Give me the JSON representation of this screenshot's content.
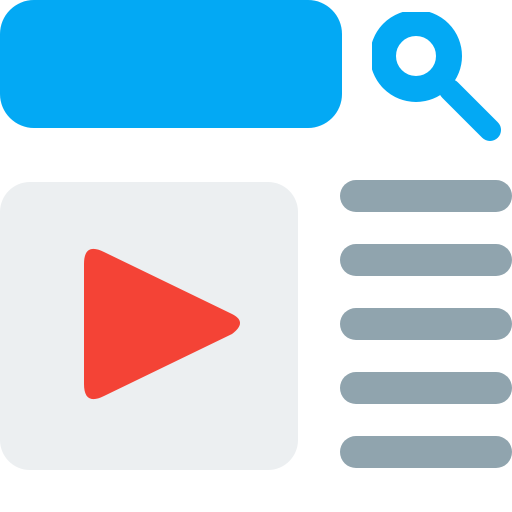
{
  "colors": {
    "accent": "#03a9f4",
    "card": "#eceff1",
    "play": "#f44336",
    "line": "#90a4ae",
    "background": "#ffffff"
  },
  "icons": {
    "search": "search-icon",
    "play": "play-icon"
  },
  "list_lines": {
    "count": 5
  }
}
